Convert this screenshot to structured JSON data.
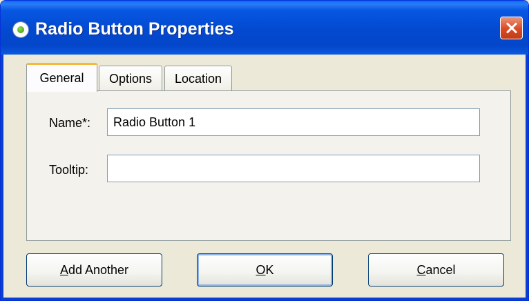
{
  "window": {
    "title": "Radio Button Properties",
    "icon": "radio-button-icon",
    "close_icon": "close-icon"
  },
  "tabs": [
    {
      "label": "General",
      "active": true
    },
    {
      "label": "Options",
      "active": false
    },
    {
      "label": "Location",
      "active": false
    }
  ],
  "form": {
    "name_label": "Name*:",
    "name_value": "Radio Button 1",
    "tooltip_label": "Tooltip:",
    "tooltip_value": ""
  },
  "buttons": {
    "add_another": {
      "accel": "A",
      "rest": "dd Another"
    },
    "ok": {
      "accel": "O",
      "rest": "K"
    },
    "cancel": {
      "accel": "C",
      "rest": "ancel"
    }
  },
  "colors": {
    "titlebar": "#0349cf",
    "close_button": "#d94a23",
    "active_tab_accent": "#f7b73b",
    "dialog_background": "#ece9d8"
  }
}
